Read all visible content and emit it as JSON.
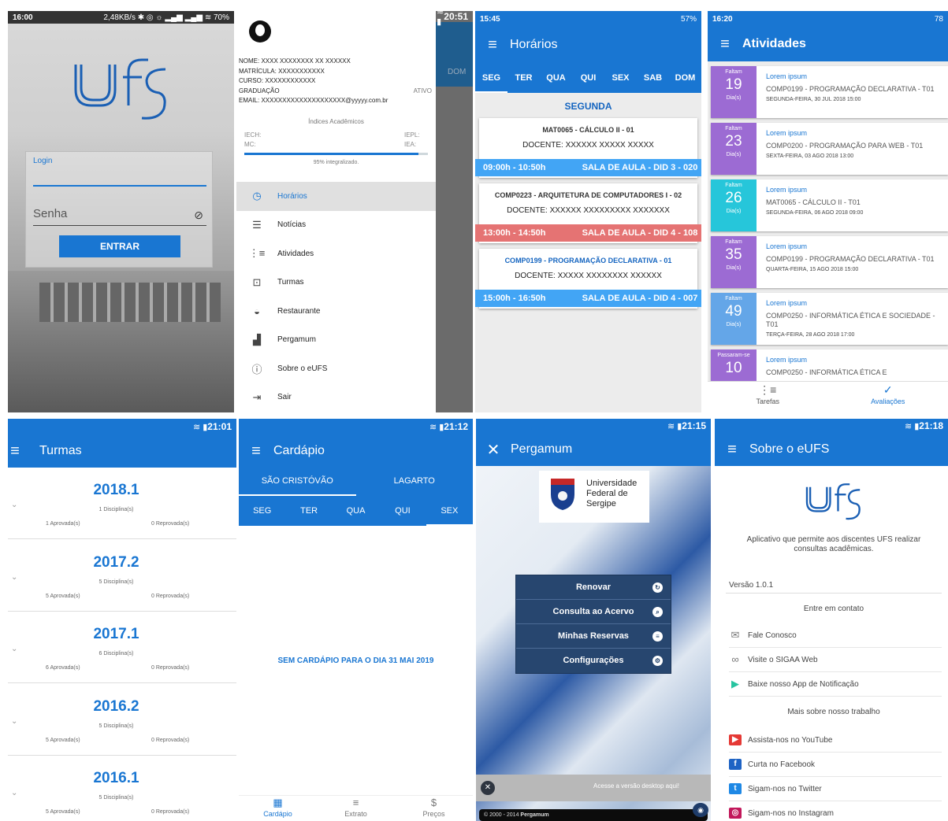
{
  "login": {
    "status_time": "16:00",
    "status_right": "2,48KB/s ✱ ◎ ☼ ▂▄▆ ▂▄▆ ≋ 70%",
    "logo": "ufs",
    "login_label": "Login",
    "password_placeholder": "Senha",
    "button": "ENTRAR"
  },
  "drawer": {
    "status_time": "20:51",
    "name": "NOME: XXXX XXXXXXXX XX XXXXXX",
    "matricula": "MATRÍCULA: XXXXXXXXXXX",
    "curso": "CURSO: XXXXXXXXXXXX",
    "grau": "GRADUAÇÃO",
    "ativo": "ATIVO",
    "email": "EMAIL: XXXXXXXXXXXXXXXXXXXX@yyyyy.com.br",
    "indices": "Índices Acadêmicos",
    "iech": "IECH:",
    "iepl": "IEPL:",
    "mc": "MC:",
    "iea": "IEA:",
    "progress": 0.95,
    "progress_label": "95% integralizado.",
    "peek": "DOM",
    "items": [
      {
        "label": "Horários",
        "icon": "clock-icon",
        "glyph": "◷"
      },
      {
        "label": "Notícias",
        "icon": "news-icon",
        "glyph": "☰"
      },
      {
        "label": "Atividades",
        "icon": "activities-icon",
        "glyph": "⋮≡"
      },
      {
        "label": "Turmas",
        "icon": "classes-icon",
        "glyph": "⊡"
      },
      {
        "label": "Restaurante",
        "icon": "restaurant-icon",
        "glyph": "◒"
      },
      {
        "label": "Pergamum",
        "icon": "library-icon",
        "glyph": "▟"
      },
      {
        "label": "Sobre o eUFS",
        "icon": "info-icon",
        "glyph": "ⓘ"
      },
      {
        "label": "Sair",
        "icon": "logout-icon",
        "glyph": "⇥"
      }
    ]
  },
  "horarios": {
    "status_time": "15:45",
    "status_right": "57%",
    "title": "Horários",
    "days": [
      "SEG",
      "TER",
      "QUA",
      "QUI",
      "SEX",
      "SAB",
      "DOM"
    ],
    "day_title": "SEGUNDA",
    "classes": [
      {
        "code": "MAT0065 - CÁLCULO II - 01",
        "teacher": "DOCENTE: XXXXXX XXXXX XXXXX",
        "time": "09:00h - 10:50h",
        "room": "SALA DE AULA - DID 3 - 020",
        "color": "#42a5f5",
        "code_color": "#333333"
      },
      {
        "code": "COMP0223 - ARQUITETURA DE COMPUTADORES I - 02",
        "teacher": "DOCENTE: XXXXXX XXXXXXXXX XXXXXXX",
        "time": "13:00h - 14:50h",
        "room": "SALA DE AULA - DID 4 - 108",
        "color": "#e57373",
        "code_color": "#333333"
      },
      {
        "code": "COMP0199 - PROGRAMAÇÃO DECLARATIVA - 01",
        "teacher": "DOCENTE: XXXXX XXXXXXXX XXXXXX",
        "time": "15:00h - 16:50h",
        "room": "SALA DE AULA - DID 4 - 007",
        "color": "#42a5f5",
        "code_color": "#1565c0"
      }
    ]
  },
  "atividades": {
    "status_time": "16:20",
    "status_right": "78",
    "title": "Atividades",
    "items": [
      {
        "top": "Faltam",
        "num": "19",
        "unit": "Dia(s)",
        "color": "#9c6bd3",
        "title": "Lorem ipsum",
        "course": "COMP0199 - PROGRAMAÇÃO DECLARATIVA - T01",
        "date": "SEGUNDA-FEIRA, 30 JUL 2018 15:00"
      },
      {
        "top": "Faltam",
        "num": "23",
        "unit": "Dia(s)",
        "color": "#9c6bd3",
        "title": "Lorem ipsum",
        "course": "COMP0200 - PROGRAMAÇÃO PARA WEB - T01",
        "date": "SEXTA-FEIRA, 03 AGO 2018 13:00"
      },
      {
        "top": "Faltam",
        "num": "26",
        "unit": "Dia(s)",
        "color": "#26c6da",
        "title": "Lorem ipsum",
        "course": "MAT0065 - CÁLCULO II - T01",
        "date": "SEGUNDA-FEIRA, 06 AGO 2018 09:00"
      },
      {
        "top": "Faltam",
        "num": "35",
        "unit": "Dia(s)",
        "color": "#9c6bd3",
        "title": "Lorem ipsum",
        "course": "COMP0199 - PROGRAMAÇÃO DECLARATIVA - T01",
        "date": "QUARTA-FEIRA, 15 AGO 2018 15:00"
      },
      {
        "top": "Faltam",
        "num": "49",
        "unit": "Dia(s)",
        "color": "#64a6e8",
        "title": "Lorem ipsum",
        "course": "COMP0250 - INFORMÁTICA ÉTICA E SOCIEDADE - T01",
        "date": "TERÇA-FEIRA, 28 AGO 2018 17:00"
      },
      {
        "top": "Passaram-se",
        "num": "10",
        "unit": "",
        "color": "#9c6bd3",
        "title": "Lorem ipsum",
        "course": "COMP0250 - INFORMÁTICA ÉTICA E",
        "date": ""
      }
    ],
    "nav": [
      {
        "label": "Tarefas",
        "glyph": "⋮≡"
      },
      {
        "label": "Avaliações",
        "glyph": "✓"
      }
    ]
  },
  "turmas": {
    "status_time": "21:01",
    "title": "Turmas",
    "semesters": [
      {
        "year": "2018.1",
        "disc": "1 Disciplina(s)",
        "ap": "1 Aprovada(s)",
        "rep": "0 Reprovada(s)"
      },
      {
        "year": "2017.2",
        "disc": "5 Disciplina(s)",
        "ap": "5 Aprovada(s)",
        "rep": "0 Reprovada(s)"
      },
      {
        "year": "2017.1",
        "disc": "6 Disciplina(s)",
        "ap": "6 Aprovada(s)",
        "rep": "0 Reprovada(s)"
      },
      {
        "year": "2016.2",
        "disc": "5 Disciplina(s)",
        "ap": "5 Aprovada(s)",
        "rep": "0 Reprovada(s)"
      },
      {
        "year": "2016.1",
        "disc": "5 Disciplina(s)",
        "ap": "5 Aprovada(s)",
        "rep": "0 Reprovada(s)"
      }
    ]
  },
  "cardapio": {
    "status_time": "21:12",
    "title": "Cardápio",
    "campus": [
      "SÃO CRISTÓVÃO",
      "LAGARTO"
    ],
    "days": [
      "SEG",
      "TER",
      "QUA",
      "QUI",
      "SEX"
    ],
    "empty": "SEM CARDÁPIO PARA O DIA 31 MAI 2019",
    "nav": [
      {
        "label": "Cardápio",
        "glyph": "▦"
      },
      {
        "label": "Extrato",
        "glyph": "≡"
      },
      {
        "label": "Preços",
        "glyph": "$"
      }
    ]
  },
  "pergamum": {
    "status_time": "21:15",
    "title": "Pergamum",
    "uni_line1": "Universidade",
    "uni_line2": "Federal de",
    "uni_line3": "Sergipe",
    "menu": [
      {
        "label": "Renovar",
        "glyph": "↻"
      },
      {
        "label": "Consulta ao Acervo",
        "glyph": "⌕"
      },
      {
        "label": "Minhas Reservas",
        "glyph": "≡"
      },
      {
        "label": "Configurações",
        "glyph": "⚙"
      }
    ],
    "desktop": "Acesse a versão desktop aqui!",
    "footer_prefix": "© 2000 - 2014 ",
    "footer_brand": "Pergamum"
  },
  "sobre": {
    "status_time": "21:18",
    "title": "Sobre o eUFS",
    "description": "Aplicativo que permite aos discentes UFS realizar consultas acadêmicas.",
    "version": "Versão 1.0.1",
    "contact_header": "Entre em contato",
    "contact": [
      {
        "label": "Fale Conosco",
        "glyph": "✉",
        "color": "#777777"
      },
      {
        "label": "Visite o SIGAA Web",
        "glyph": "∞",
        "color": "#777777"
      },
      {
        "label": "Baixe nosso App de Notificação",
        "glyph": "▶",
        "color": "#27c4a0"
      }
    ],
    "more_header": "Mais sobre nosso trabalho",
    "social": [
      {
        "label": "Assista-nos no YouTube",
        "glyph": "▶",
        "color": "#e53935"
      },
      {
        "label": "Curta no Facebook",
        "glyph": "f",
        "color": "#1e63c4"
      },
      {
        "label": "Sigam-nos no Twitter",
        "glyph": "t",
        "color": "#1e88e5"
      },
      {
        "label": "Sigam-nos no Instagram",
        "glyph": "◎",
        "color": "#c2185b"
      }
    ]
  }
}
